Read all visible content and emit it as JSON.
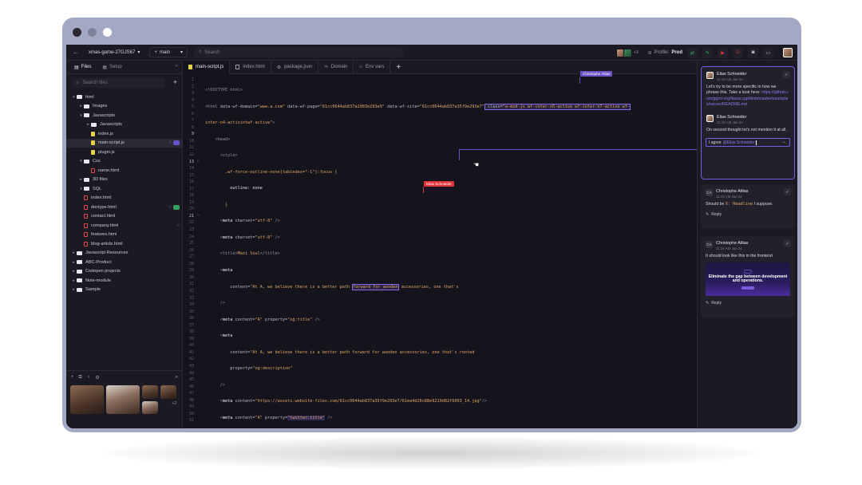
{
  "project": "xmas-game-27GJS67",
  "branch": "main",
  "search_placeholder": "Search",
  "profile": {
    "label": "Profile:",
    "value": "Prod"
  },
  "presence_more": "+3",
  "sidebar": {
    "tabs": [
      {
        "label": "Files"
      },
      {
        "label": "Setup"
      }
    ],
    "search_placeholder": "Search files",
    "tree": [
      {
        "label": "html",
        "depth": 0,
        "kind": "folder",
        "open": true
      },
      {
        "label": "Images",
        "depth": 1,
        "kind": "folder",
        "open": false
      },
      {
        "label": "Javascripts",
        "depth": 1,
        "kind": "folder",
        "open": true
      },
      {
        "label": "Javascripts",
        "depth": 2,
        "kind": "folder",
        "open": false
      },
      {
        "label": "index.js",
        "depth": 2,
        "kind": "js"
      },
      {
        "label": "main-script.js",
        "depth": 2,
        "kind": "js",
        "selected": true
      },
      {
        "label": "plugin.js",
        "depth": 2,
        "kind": "js"
      },
      {
        "label": "Css",
        "depth": 1,
        "kind": "folder",
        "open": true
      },
      {
        "label": "name.html",
        "depth": 2,
        "kind": "html"
      },
      {
        "label": "3D files",
        "depth": 1,
        "kind": "folder",
        "open": false
      },
      {
        "label": "SQL",
        "depth": 1,
        "kind": "folder",
        "open": true
      },
      {
        "label": "index.html",
        "depth": 1,
        "kind": "html"
      },
      {
        "label": "doctype.html",
        "depth": 1,
        "kind": "html",
        "badge": "green"
      },
      {
        "label": "contact.html",
        "depth": 1,
        "kind": "html"
      },
      {
        "label": "company.html",
        "depth": 1,
        "kind": "html",
        "comment": true
      },
      {
        "label": "features.html",
        "depth": 1,
        "kind": "html"
      },
      {
        "label": "blog-article.html",
        "depth": 1,
        "kind": "html"
      },
      {
        "label": "Javascript Resources",
        "depth": 0,
        "kind": "folder",
        "open": false
      },
      {
        "label": "ABC-Product",
        "depth": 0,
        "kind": "folder",
        "open": false
      },
      {
        "label": "Codepen projects",
        "depth": 0,
        "kind": "folder",
        "open": false
      },
      {
        "label": "Note-module",
        "depth": 0,
        "kind": "folder",
        "open": false
      },
      {
        "label": "Sample",
        "depth": 0,
        "kind": "folder",
        "open": false
      }
    ],
    "video_more": "+2"
  },
  "tabs": [
    {
      "label": "main-script.js",
      "icon": "js-icon",
      "active": true
    },
    {
      "label": "index.html",
      "icon": "html-icon"
    },
    {
      "label": "package.json",
      "icon": "gear-icon"
    },
    {
      "label": "Domain",
      "icon": "link-icon"
    },
    {
      "label": "Env vars",
      "icon": "env-icon"
    }
  ],
  "code": {
    "line_count": 51,
    "cursors": {
      "christophe": "Christophe Atlias",
      "elias": "Elias Schneider"
    }
  },
  "comments": [
    {
      "author": "Elias Schneider",
      "time": "11:16 AM Jan 24",
      "text": "Let's try to be more specific in how we phrase this. Take a look here:",
      "link": "https://github.com/ggml-org/llama.cpp/blob/master/examples/server/README.md",
      "reply_author": "Elias Schneider",
      "reply_time": "11:16 AM Jan 24",
      "reply_text": "On second thought let's not mention it at all.",
      "input_text": "I agree ",
      "input_mention": "@Elias Schneider"
    },
    {
      "author": "Christophe Atlias",
      "initials": "CA",
      "time": "11:16 AM Jan 24",
      "text_before": "Should be ",
      "text_code": "X: Headline",
      "text_after": " I suppose.",
      "reply_label": "Reply"
    },
    {
      "author": "Christophe Atlias",
      "initials": "CA",
      "time": "11:16 AM Jan 24",
      "text": "It should look like this in the frontend",
      "thumb_title": "Eliminate the gap between development and operations.",
      "reply_label": "Reply"
    }
  ],
  "colors": {
    "accent": "#7b5ce0",
    "elias_cursor": "#e0333a",
    "christophe_cursor": "#6a52c8"
  }
}
